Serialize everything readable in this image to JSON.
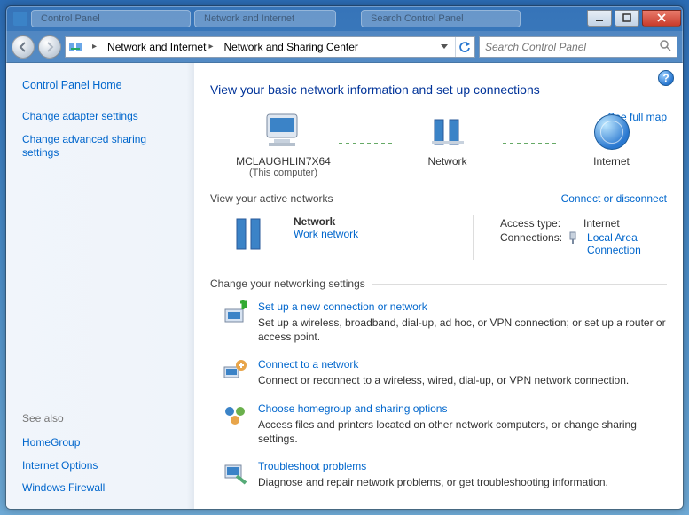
{
  "window": {
    "ghost_tab1": "Control Panel",
    "ghost_tab2": "Network and Internet",
    "search_ghost": "Search Control Panel"
  },
  "address": {
    "seg1": "Network and Internet",
    "seg2": "Network and Sharing Center"
  },
  "search": {
    "placeholder": "Search Control Panel"
  },
  "sidebar": {
    "home": "Control Panel Home",
    "task1": "Change adapter settings",
    "task2": "Change advanced sharing settings",
    "see_also": "See also",
    "sa1": "HomeGroup",
    "sa2": "Internet Options",
    "sa3": "Windows Firewall"
  },
  "main": {
    "title": "View your basic network information and set up connections",
    "fullmap": "See full map",
    "map": {
      "pc_name": "MCLAUGHLIN7X64",
      "pc_sub": "(This computer)",
      "net": "Network",
      "internet": "Internet"
    },
    "active_h": "View your active networks",
    "connect_or": "Connect or disconnect",
    "net_name": "Network",
    "net_type": "Work network",
    "props": {
      "access_k": "Access type:",
      "access_v": "Internet",
      "conn_k": "Connections:",
      "conn_v": "Local Area Connection"
    },
    "change_h": "Change your networking settings",
    "tasks": {
      "t1t": "Set up a new connection or network",
      "t1d": "Set up a wireless, broadband, dial-up, ad hoc, or VPN connection; or set up a router or access point.",
      "t2t": "Connect to a network",
      "t2d": "Connect or reconnect to a wireless, wired, dial-up, or VPN network connection.",
      "t3t": "Choose homegroup and sharing options",
      "t3d": "Access files and printers located on other network computers, or change sharing settings.",
      "t4t": "Troubleshoot problems",
      "t4d": "Diagnose and repair network problems, or get troubleshooting information."
    }
  }
}
